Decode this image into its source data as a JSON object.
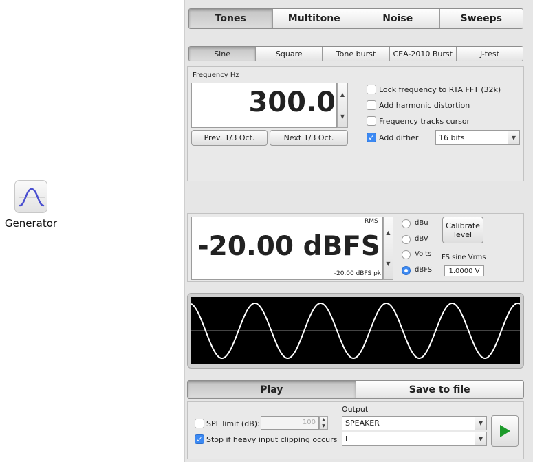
{
  "desktop": {
    "icon": "sine-wave-icon",
    "label": "Generator"
  },
  "main_tabs": {
    "items": [
      "Tones",
      "Multitone",
      "Noise",
      "Sweeps"
    ],
    "selected": "Tones"
  },
  "sub_tabs": {
    "items": [
      "Sine",
      "Square",
      "Tone burst",
      "CEA-2010 Burst",
      "J-test"
    ],
    "selected": "Sine"
  },
  "frequency": {
    "caption": "Frequency Hz",
    "value": "300.0",
    "prev_label": "Prev. 1/3 Oct.",
    "next_label": "Next 1/3 Oct."
  },
  "options": {
    "lock_label": "Lock frequency to RTA FFT (32k)",
    "lock_checked": false,
    "harmonic_label": "Add harmonic distortion",
    "harmonic_checked": false,
    "tracks_label": "Frequency tracks cursor",
    "tracks_checked": false,
    "dither_label": "Add dither",
    "dither_checked": true,
    "dither_bits": "16 bits"
  },
  "level": {
    "rms_label": "RMS",
    "value": "-20.00 dBFS",
    "peak_label": "-20.00 dBFS pk",
    "units": [
      "dBu",
      "dBV",
      "Volts",
      "dBFS"
    ],
    "selected_unit": "dBFS",
    "calibrate_label": "Calibrate\nlevel",
    "fs_label": "FS sine Vrms",
    "fs_value": "1.0000 V"
  },
  "waveform": {
    "cycles": 5,
    "background": "#000000",
    "trace": "#ffffff"
  },
  "play_tabs": {
    "play_label": "Play",
    "save_label": "Save to file",
    "selected": "Play"
  },
  "output": {
    "caption": "Output",
    "spl_label": "SPL limit (dB):",
    "spl_checked": false,
    "spl_value": "100",
    "stop_label": "Stop if heavy input clipping occurs",
    "stop_checked": true,
    "device": "SPEAKER",
    "channel": "L",
    "play_icon": "play-triangle-icon",
    "accent": "#1c9a2a"
  }
}
